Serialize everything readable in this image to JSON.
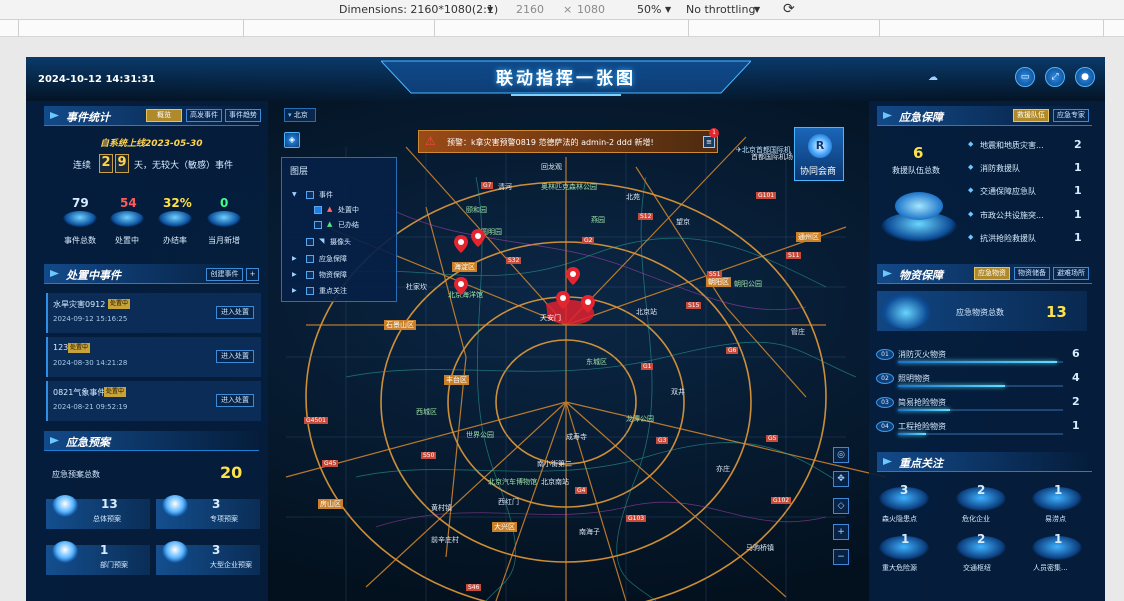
{
  "devtools": {
    "dimensions": "Dimensions: 2160*1080(2:1)",
    "width": "2160",
    "x": "×",
    "height": "1080",
    "zoom": "50%",
    "throttle": "No throttling"
  },
  "header": {
    "title": "联动指挥一张图",
    "datetime": "2024-10-12 14:31:31"
  },
  "event_stats": {
    "title": "事件统计",
    "tabs": [
      "概览",
      "高发事件",
      "事件趋势"
    ],
    "since": "自系统上线2023-05-30",
    "streak_prefix": "连续",
    "streak_d1": "2",
    "streak_d2": "9",
    "streak_suffix": "天，无较大（敏感）事件",
    "stats": [
      {
        "value": "79",
        "label": "事件总数",
        "color": "#ffffff"
      },
      {
        "value": "54",
        "label": "处置中",
        "color": "#ff5b5b"
      },
      {
        "value": "32%",
        "label": "办结率",
        "color": "#ffe14a"
      },
      {
        "value": "0",
        "label": "当月新增",
        "color": "#3dff8a"
      }
    ]
  },
  "handling": {
    "title": "处置中事件",
    "create": "创建事件",
    "plus": "+",
    "items": [
      {
        "name": "水旱灾害0912",
        "badge": "处置中",
        "time": "2024-09-12 15:16:25",
        "action": "进入处置"
      },
      {
        "name": "123",
        "badge": "处置中",
        "time": "2024-08-30 14:21:28",
        "action": "进入处置"
      },
      {
        "name": "0821气象事件",
        "badge": "处置中",
        "time": "2024-08-21 09:52:19",
        "action": "进入处置"
      }
    ]
  },
  "plans": {
    "title": "应急预案",
    "total_label": "应急预案总数",
    "total": "20",
    "cards": [
      {
        "value": "13",
        "label": "总体预案"
      },
      {
        "value": "3",
        "label": "专项预案"
      },
      {
        "value": "1",
        "label": "部门预案"
      },
      {
        "value": "3",
        "label": "大型企业预案"
      }
    ]
  },
  "map": {
    "city": "北京",
    "alert": "预警：k拿灾害预警0819   范德萨法的   admin-2   ddd   新增!",
    "alert_count": "1",
    "station": "北京首都国际机",
    "meet_label": "协同会商",
    "layers": {
      "title": "图层",
      "items": [
        "事件",
        "处置中",
        "已办结",
        "摄像头",
        "应急保障",
        "物资保障",
        "重点关注"
      ]
    },
    "tool_icons": [
      "target-icon",
      "move-icon",
      "locate-icon",
      "zoom-in-icon",
      "zoom-out-icon"
    ],
    "labels": [
      "天安门",
      "海淀区",
      "石景山区",
      "丰台区",
      "朝阳区",
      "大兴区",
      "房山区",
      "首都国际机场",
      "北京站",
      "颐和园",
      "圆明园",
      "奥林匹克森林公园",
      "东城区",
      "西城区",
      "通州区",
      "龙潭公园",
      "朝阳公园",
      "南海子",
      "南小街第二",
      "北京南站",
      "亦庄",
      "回龙观",
      "清河",
      "望京",
      "双井",
      "杜家坎",
      "黄村镇",
      "前辛庄村",
      "成寿寺",
      "燕园",
      "马驹桥镇",
      "北苑",
      "世界公园",
      "北京汽车博物馆",
      "西红门",
      "管庄",
      "北京海洋馆"
    ],
    "roads": [
      "G7",
      "S12",
      "S51",
      "G6",
      "G1",
      "G2",
      "G3",
      "G4501",
      "G4",
      "S32",
      "G101",
      "G102",
      "G103",
      "S11",
      "S15",
      "G45",
      "S50",
      "G5",
      "S46"
    ]
  },
  "emergency": {
    "title": "应急保障",
    "tabs": [
      "救援队伍",
      "应急专家"
    ],
    "total": "6",
    "total_label": "救援队伍总数",
    "teams": [
      {
        "name": "地震和地质灾害...",
        "value": "2"
      },
      {
        "name": "消防救援队",
        "value": "1"
      },
      {
        "name": "交通保障应急队",
        "value": "1"
      },
      {
        "name": "市政公共设施突...",
        "value": "1"
      },
      {
        "name": "抗洪抢险救援队",
        "value": "1"
      }
    ]
  },
  "materials": {
    "title": "物资保障",
    "tabs": [
      "应急物资",
      "物资储备",
      "避难场所"
    ],
    "total_label": "应急物资总数",
    "total": "13",
    "items": [
      {
        "rank": "01",
        "name": "消防灭火物资",
        "value": "6",
        "ratio": 0.46
      },
      {
        "rank": "02",
        "name": "照明物资",
        "value": "4",
        "ratio": 0.31
      },
      {
        "rank": "03",
        "name": "简易抢险物资",
        "value": "2",
        "ratio": 0.15
      },
      {
        "rank": "04",
        "name": "工程抢险物资",
        "value": "1",
        "ratio": 0.08
      }
    ]
  },
  "focus": {
    "title": "重点关注",
    "items": [
      {
        "value": "3",
        "label": "森火隐患点"
      },
      {
        "value": "2",
        "label": "危化企业"
      },
      {
        "value": "1",
        "label": "易涝点"
      },
      {
        "value": "1",
        "label": "重大危险源"
      },
      {
        "value": "2",
        "label": "交通枢纽"
      },
      {
        "value": "1",
        "label": "人员密集..."
      }
    ]
  }
}
